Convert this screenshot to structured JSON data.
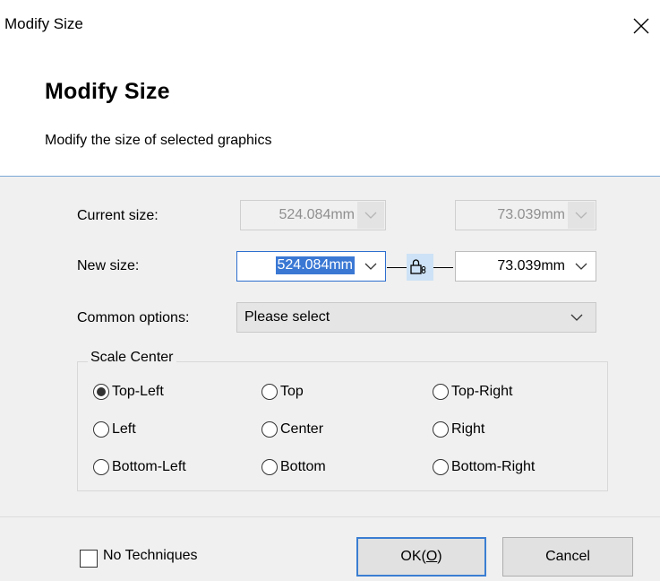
{
  "window": {
    "title": "Modify Size"
  },
  "header": {
    "title": "Modify Size",
    "subtitle": "Modify the size of selected graphics"
  },
  "form": {
    "current_size": {
      "label": "Current size:",
      "width": "524.084mm",
      "height": "73.039mm"
    },
    "new_size": {
      "label": "New size:",
      "width": "524.084mm",
      "height": "73.039mm"
    },
    "common_options": {
      "label": "Common options:",
      "selected": "Please select"
    }
  },
  "scale_center": {
    "title": "Scale Center",
    "options": [
      "Top-Left",
      "Top",
      "Top-Right",
      "Left",
      "Center",
      "Right",
      "Bottom-Left",
      "Bottom",
      "Bottom-Right"
    ],
    "selected": "Top-Left"
  },
  "footer": {
    "no_techniques_label": "No Techniques",
    "no_techniques_checked": false,
    "ok_label": "OK(",
    "ok_mnemonic": "O",
    "ok_suffix": ")",
    "cancel_label": "Cancel"
  },
  "colors": {
    "accent": "#3a78d4",
    "panel": "#f0f0f0",
    "lock_bg": "#cde2f6"
  },
  "icons": [
    "close-icon",
    "chevron-down-icon",
    "lock-icon"
  ]
}
